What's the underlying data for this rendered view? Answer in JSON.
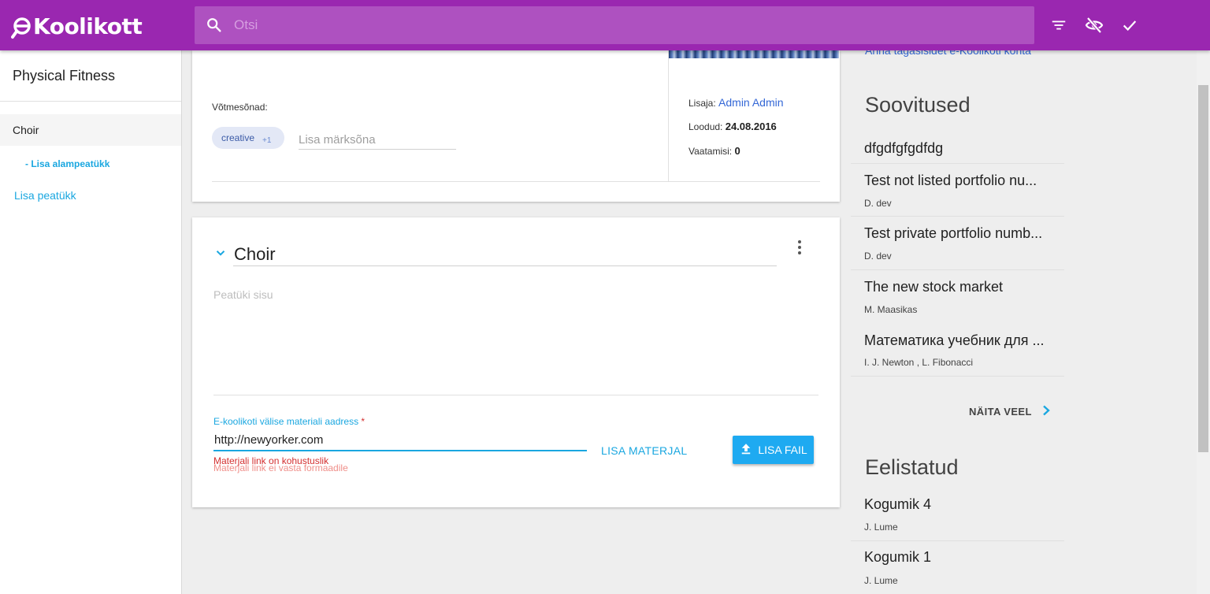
{
  "app": {
    "logo_text": "Koolikott"
  },
  "search": {
    "placeholder": "Otsi"
  },
  "toolbar_icons": [
    "filter-icon",
    "eye-off-icon",
    "check-icon"
  ],
  "sidebar": {
    "title": "Physical Fitness",
    "chapter": "Choir",
    "add_subchapter": "- Lisa alampeatükk",
    "add_chapter": "Lisa peatükk"
  },
  "portfolio": {
    "keywords_label": "Võtmesõnad:",
    "keyword_chip": "creative",
    "keyword_extra": "+1",
    "keyword_placeholder": "Lisa märksõna",
    "added_by_label": "Lisaja: ",
    "added_by": "Admin Admin",
    "created_label": "Loodud: ",
    "created": "24.08.2016",
    "views_label": "Vaatamisi: ",
    "views": "0"
  },
  "chapter": {
    "title": "Choir",
    "content_placeholder": "Peatüki sisu",
    "url_label": "E-koolikoti välise materiali aadress",
    "url_required": "*",
    "url_value": "http://newyorker.com",
    "error_required": "Materjali link on kohustuslik",
    "error_format": "Materjali link ei vasta formaadile",
    "add_material": "LISA MATERJAL",
    "add_file": "LISA FAIL"
  },
  "right": {
    "feedback_link": "Anna tagasisidet e-Koolikoti kohta",
    "recommendations_title": "Soovitused",
    "recommendations": [
      {
        "title": "dfgdfgfgdfdg",
        "author": ""
      },
      {
        "title": "Test not listed portfolio nu...",
        "author": "D. dev"
      },
      {
        "title": "Test private portfolio numb...",
        "author": "D. dev"
      },
      {
        "title": "The new stock market",
        "author": "M. Maasikas"
      },
      {
        "title": "Математика учебник для ...",
        "author": "I. J. Newton , L. Fibonacci"
      }
    ],
    "show_more": "NÄITA VEEL",
    "favorites_title": "Eelistatud",
    "favorites": [
      {
        "title": "Kogumik 4",
        "author": "J. Lume"
      },
      {
        "title": "Kogumik 1",
        "author": "J. Lume"
      }
    ]
  },
  "colors": {
    "primary": "#9a27b0",
    "accent": "#1aa7e0",
    "error": "#d32f2f"
  }
}
